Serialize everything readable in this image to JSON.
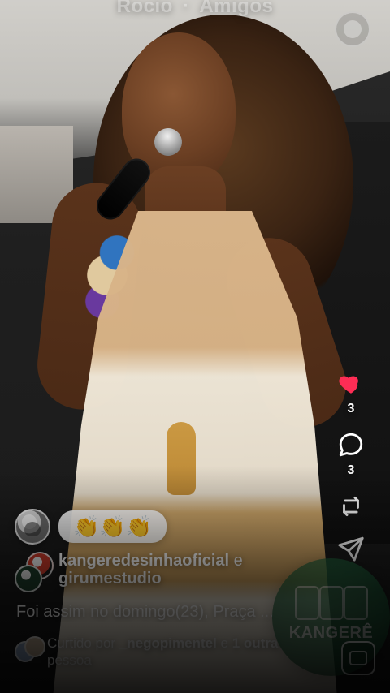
{
  "header": {
    "title_left": "Rocio",
    "title_right": "Amigos"
  },
  "comment": {
    "emoji_text": "👏👏👏"
  },
  "post": {
    "author_line_1": "kangeredesinhaoficial",
    "author_join": "e",
    "author_line_2": "girumestudio",
    "caption": "Foi assim no domingo(23), Praça ...",
    "liked_prefix": "Curtido por",
    "liked_user": "_negopimentel",
    "liked_join": "e",
    "liked_count": "1 outra",
    "liked_suffix": "pessoa"
  },
  "rail": {
    "likes_count": "3",
    "comments_count": "3"
  },
  "logo": {
    "wordmark": "KANGERÊ"
  },
  "icons": {
    "heart": "heart-icon",
    "comment": "comment-icon",
    "repost": "repost-icon",
    "send": "send-icon"
  },
  "colors": {
    "heart": "#ff2d55",
    "text": "#ffffff"
  }
}
